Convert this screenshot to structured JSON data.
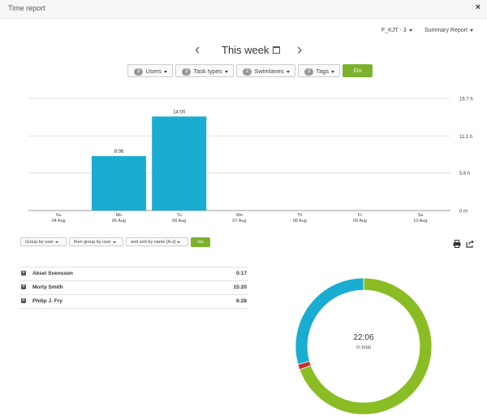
{
  "window": {
    "title": "Time report",
    "close_glyph": "×"
  },
  "toolbar": {
    "board_selector": "F_KJT - 3",
    "report_type": "Summary Report"
  },
  "week_nav": {
    "prev_glyph": "‹",
    "next_glyph": "›",
    "label": "This week"
  },
  "filters": [
    {
      "count": "3",
      "label": "Users"
    },
    {
      "count": "3",
      "label": "Task types"
    },
    {
      "count": "2",
      "label": "Swimlanes"
    },
    {
      "count": "3",
      "label": "Tags"
    }
  ],
  "go_label": "Go",
  "chart_data": {
    "type": "bar",
    "categories": [
      {
        "day": "Su",
        "date": "04 Aug"
      },
      {
        "day": "Mo",
        "date": "05 Aug"
      },
      {
        "day": "Tu",
        "date": "06 Aug"
      },
      {
        "day": "We",
        "date": "07 Aug"
      },
      {
        "day": "Th",
        "date": "08 Aug"
      },
      {
        "day": "Fr",
        "date": "09 Aug"
      },
      {
        "day": "Sa",
        "date": "10 Aug"
      }
    ],
    "values": [
      0,
      8.1,
      14.0,
      0,
      0,
      0,
      0
    ],
    "value_labels": [
      "",
      "8:06",
      "14:00",
      "",
      "",
      "",
      ""
    ],
    "y_ticks": [
      {
        "value": 0,
        "label": "0 m"
      },
      {
        "value": 5.6,
        "label": "5.6 h"
      },
      {
        "value": 11.1,
        "label": "11.1 h"
      },
      {
        "value": 16.7,
        "label": "16.7 h"
      }
    ],
    "ylim": [
      0,
      16.7
    ],
    "bar_color": "#1aacd1",
    "grid": true
  },
  "grouping": {
    "group_by": "Group by user",
    "then_group_by": "then group by user",
    "sort_by": "and sort by name [A-z]",
    "go_label": "Go"
  },
  "icons": {
    "print": "print-icon",
    "export": "export-icon"
  },
  "users": [
    {
      "name": "Aksel Svensson",
      "time": "0:17"
    },
    {
      "name": "Morty Smith",
      "time": "15:20"
    },
    {
      "name": "Philip J. Fry",
      "time": "6:28"
    }
  ],
  "donut": {
    "total": "22:06",
    "caption": "in total",
    "segments": [
      {
        "user": "Morty Smith",
        "minutes": 920,
        "color": "#8abd24"
      },
      {
        "user": "Aksel Svensson",
        "minutes": 17,
        "color": "#c9302c"
      },
      {
        "user": "Philip J. Fry",
        "minutes": 388,
        "color": "#1aacd1"
      }
    ]
  }
}
